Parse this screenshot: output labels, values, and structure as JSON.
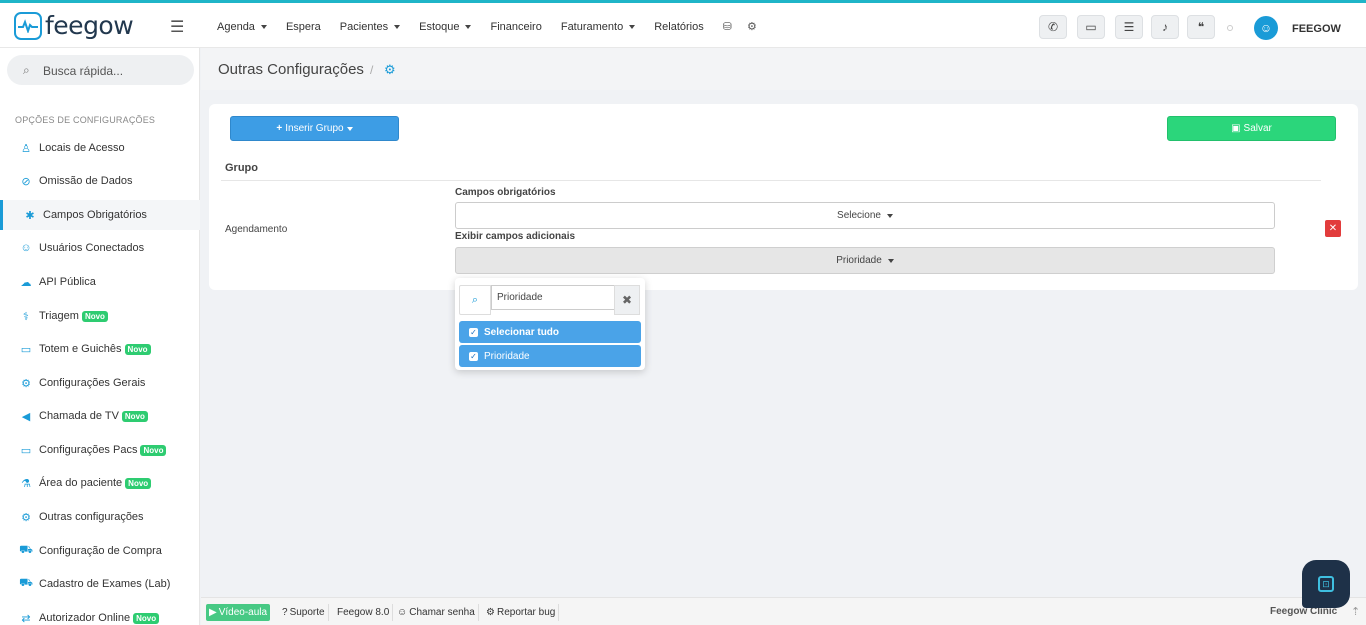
{
  "brand": {
    "logo_text": "feegow"
  },
  "nav": {
    "items": [
      {
        "label": "Agenda",
        "caret": true
      },
      {
        "label": "Espera",
        "caret": false
      },
      {
        "label": "Pacientes",
        "caret": true
      },
      {
        "label": "Estoque",
        "caret": true
      },
      {
        "label": "Financeiro",
        "caret": false
      },
      {
        "label": "Faturamento",
        "caret": true
      },
      {
        "label": "Relatórios",
        "caret": false
      }
    ]
  },
  "user": {
    "name": "FEEGOW"
  },
  "sidebar": {
    "search_placeholder": "Busca rápida...",
    "section_title": "OPÇÕES DE CONFIGURAÇÕES",
    "items": [
      {
        "label": "Locais de Acesso",
        "icon": "tower-icon",
        "glyph": "♙",
        "badge": ""
      },
      {
        "label": "Omissão de Dados",
        "icon": "eye-slash-icon",
        "glyph": "⊘",
        "badge": ""
      },
      {
        "label": "Campos Obrigatórios",
        "icon": "asterisk-icon",
        "glyph": "✱",
        "badge": ""
      },
      {
        "label": "Usuários Conectados",
        "icon": "user-icon",
        "glyph": "☺",
        "badge": ""
      },
      {
        "label": "API Pública",
        "icon": "cloud-icon",
        "glyph": "☁",
        "badge": ""
      },
      {
        "label": "Triagem",
        "icon": "stethoscope-icon",
        "glyph": "⚕",
        "badge": "Novo"
      },
      {
        "label": "Totem e Guichês",
        "icon": "laptop-icon",
        "glyph": "▭",
        "badge": "Novo"
      },
      {
        "label": "Configurações Gerais",
        "icon": "cogs-icon",
        "glyph": "⚙",
        "badge": ""
      },
      {
        "label": "Chamada de TV",
        "icon": "bullhorn-icon",
        "glyph": "◀",
        "badge": "Novo"
      },
      {
        "label": "Configurações Pacs",
        "icon": "laptop-icon",
        "glyph": "▭",
        "badge": "Novo"
      },
      {
        "label": "Área do paciente",
        "icon": "flask-icon",
        "glyph": "⚗",
        "badge": "Novo"
      },
      {
        "label": "Outras configurações",
        "icon": "cogs-icon",
        "glyph": "⚙",
        "badge": ""
      },
      {
        "label": "Configuração de Compra",
        "icon": "cart-icon",
        "glyph": "⛟",
        "badge": ""
      },
      {
        "label": "Cadastro de Exames (Lab)",
        "icon": "cart-icon",
        "glyph": "⛟",
        "badge": ""
      },
      {
        "label": "Autorizador Online",
        "icon": "exchange-icon",
        "glyph": "⇄",
        "badge": "Novo"
      }
    ]
  },
  "page": {
    "title": "Outras Configurações"
  },
  "panel": {
    "insert_group_label": "Inserir Grupo",
    "save_label": "Salvar",
    "group_header": "Grupo",
    "row_label": "Agendamento",
    "required_fields_label": "Campos obrigatórios",
    "required_fields_value": "Selecione",
    "extra_fields_label": "Exibir campos adicionais",
    "extra_fields_value": "Prioridade"
  },
  "dropdown": {
    "search_value": "Prioridade",
    "options": [
      {
        "label": "Selecionar tudo",
        "checked": true
      },
      {
        "label": "Prioridade",
        "checked": true
      }
    ]
  },
  "footer": {
    "video": "Vídeo-aula",
    "support": "Suporte",
    "version": "Feegow 8.0",
    "call": "Chamar senha",
    "bug": "Reportar bug",
    "brand": "Feegow Clinic"
  },
  "colors": {
    "primary": "#1a9bd7",
    "success": "#2bd67b",
    "danger": "#e23c3c",
    "badge": "#2ecc71"
  }
}
